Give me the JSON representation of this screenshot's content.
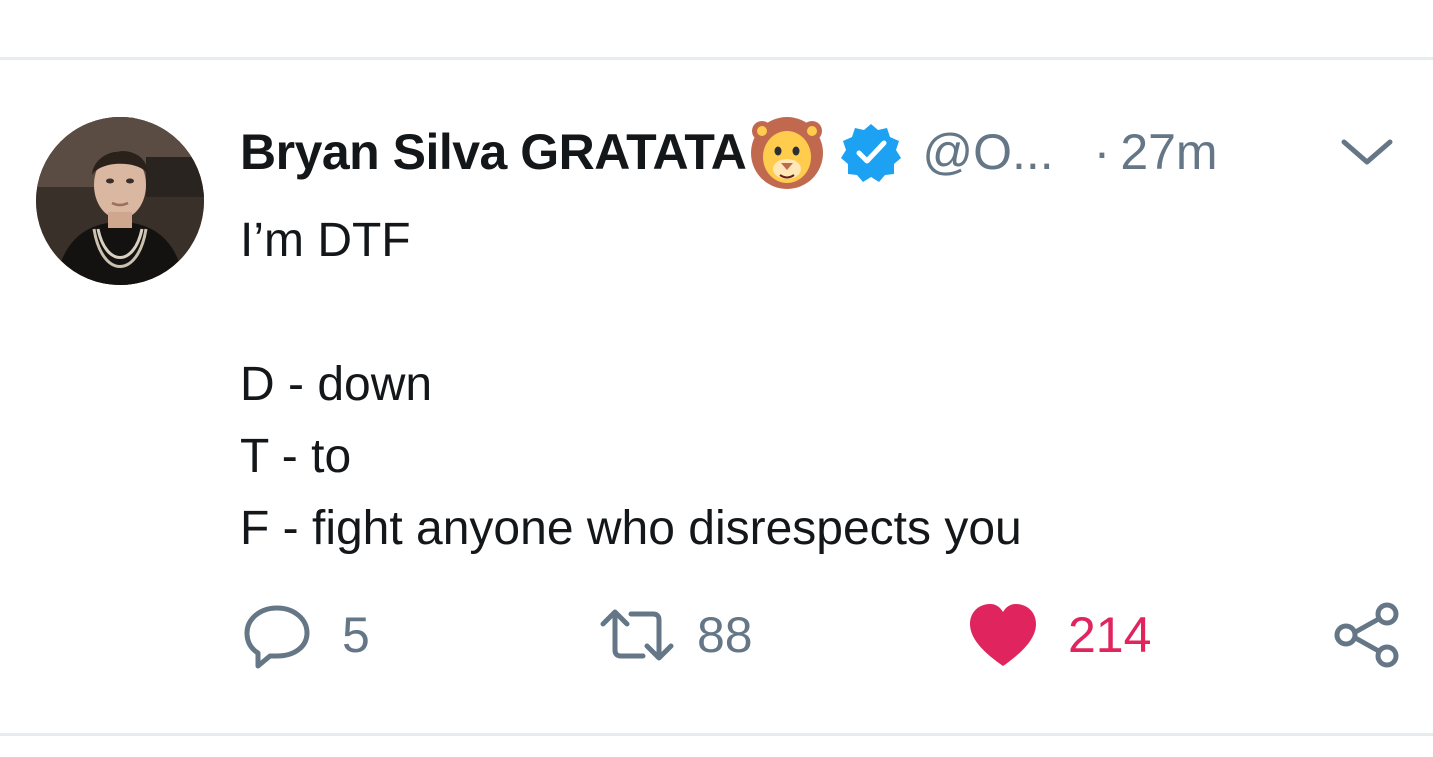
{
  "tweet": {
    "author": {
      "display_name": "Bryan Silva GRATATA",
      "name_emoji": "lion-face-emoji",
      "verified": true,
      "handle": "@O...",
      "avatar": "user-photo-avatar"
    },
    "separator": "·",
    "timestamp": "27m",
    "body_lines": [
      "I’m DTF",
      "",
      "D - down",
      "T - to",
      "F - fight anyone who disrespects you"
    ],
    "actions": {
      "reply": {
        "icon": "speech-bubble-icon",
        "count": "5"
      },
      "retweet": {
        "icon": "retweet-arrows-icon",
        "count": "88"
      },
      "like": {
        "icon": "heart-icon",
        "count": "214",
        "liked": true
      },
      "share": {
        "icon": "share-nodes-icon"
      }
    },
    "menu_icon": "chevron-down-icon"
  },
  "colors": {
    "text_primary": "#14171a",
    "text_secondary": "#657786",
    "like_active": "#e0245e",
    "verified_blue": "#1da1f2",
    "divider": "#e6ecf0"
  }
}
